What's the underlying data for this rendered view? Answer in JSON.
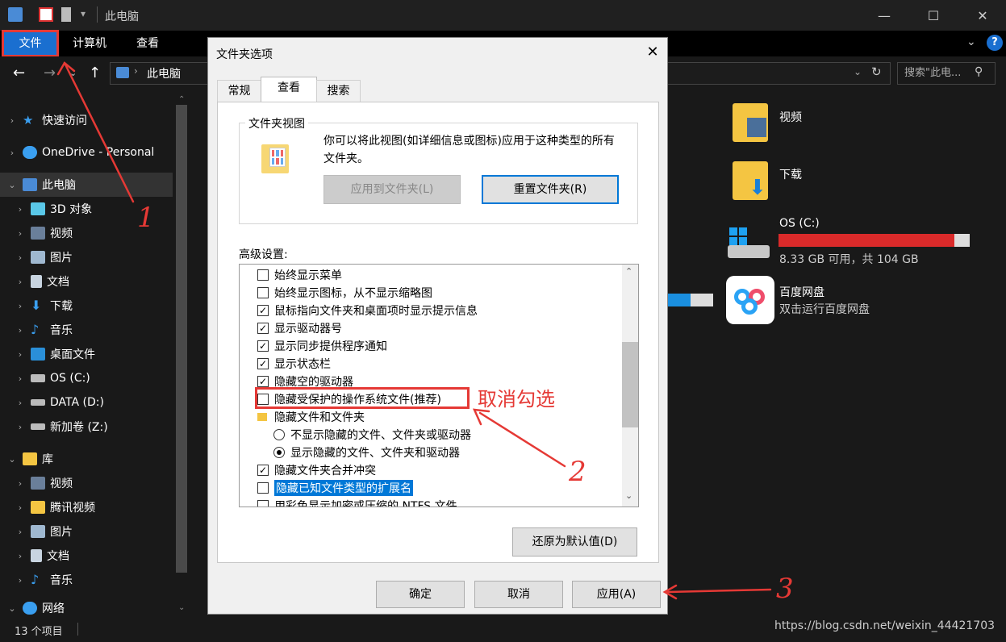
{
  "explorer": {
    "window_title": "此电脑",
    "ribbon_tabs": [
      "文件",
      "计算机",
      "查看"
    ],
    "address_path": "此电脑",
    "search_placeholder": "搜索\"此电...",
    "sidebar": [
      {
        "label": "快速访问",
        "icon": "star-icon"
      },
      {
        "label": "OneDrive - Personal",
        "icon": "cloud-icon"
      },
      {
        "label": "此电脑",
        "icon": "computer-icon"
      },
      {
        "label": "3D 对象",
        "icon": "cube-icon"
      },
      {
        "label": "视频",
        "icon": "video-icon"
      },
      {
        "label": "图片",
        "icon": "picture-icon"
      },
      {
        "label": "文档",
        "icon": "document-icon"
      },
      {
        "label": "下载",
        "icon": "download-icon"
      },
      {
        "label": "音乐",
        "icon": "music-icon"
      },
      {
        "label": "桌面文件",
        "icon": "desktop-icon"
      },
      {
        "label": "OS (C:)",
        "icon": "drive-icon"
      },
      {
        "label": "DATA (D:)",
        "icon": "drive-icon"
      },
      {
        "label": "新加卷 (Z:)",
        "icon": "drive-icon"
      },
      {
        "label": "库",
        "icon": "library-icon"
      },
      {
        "label": "视频",
        "icon": "video-icon"
      },
      {
        "label": "腾讯视频",
        "icon": "folder-icon"
      },
      {
        "label": "图片",
        "icon": "picture-icon"
      },
      {
        "label": "文档",
        "icon": "document-icon"
      },
      {
        "label": "音乐",
        "icon": "music-icon"
      },
      {
        "label": "网络",
        "icon": "network-icon"
      }
    ],
    "right_pane": {
      "videos": "视频",
      "downloads": "下载",
      "drive_c_name": "OS (C:)",
      "drive_c_free": "8.33 GB 可用，共 104 GB",
      "drive_c_used_fraction": 0.92,
      "baidu_name": "百度网盘",
      "baidu_desc": "双击运行百度网盘"
    },
    "status_count": "13 个项目",
    "watermark": "https://blog.csdn.net/weixin_44421703"
  },
  "dialog": {
    "title": "文件夹选项",
    "tabs": [
      "常规",
      "查看",
      "搜索"
    ],
    "folder_views_legend": "文件夹视图",
    "folder_views_desc": "你可以将此视图(如详细信息或图标)应用于这种类型的所有文件夹。",
    "btn_apply_to_folders": "应用到文件夹(L)",
    "btn_reset_folders": "重置文件夹(R)",
    "advanced_label": "高级设置:",
    "advanced_items": [
      {
        "label": "始终显示菜单",
        "type": "checkbox",
        "checked": false
      },
      {
        "label": "始终显示图标，从不显示缩略图",
        "type": "checkbox",
        "checked": false
      },
      {
        "label": "鼠标指向文件夹和桌面项时显示提示信息",
        "type": "checkbox",
        "checked": true
      },
      {
        "label": "显示驱动器号",
        "type": "checkbox",
        "checked": true
      },
      {
        "label": "显示同步提供程序通知",
        "type": "checkbox",
        "checked": true
      },
      {
        "label": "显示状态栏",
        "type": "checkbox",
        "checked": true
      },
      {
        "label": "隐藏空的驱动器",
        "type": "checkbox",
        "checked": true
      },
      {
        "label": "隐藏受保护的操作系统文件(推荐)",
        "type": "checkbox",
        "checked": false
      },
      {
        "label": "隐藏文件和文件夹",
        "type": "folder"
      },
      {
        "label": "不显示隐藏的文件、文件夹或驱动器",
        "type": "radio",
        "checked": false
      },
      {
        "label": "显示隐藏的文件、文件夹和驱动器",
        "type": "radio",
        "checked": true
      },
      {
        "label": "隐藏文件夹合并冲突",
        "type": "checkbox",
        "checked": true
      },
      {
        "label": "隐藏已知文件类型的扩展名",
        "type": "checkbox",
        "checked": false,
        "selected": true
      },
      {
        "label": "用彩色显示加密或压缩的 NTFS 文件",
        "type": "checkbox",
        "checked": false
      }
    ],
    "btn_restore_defaults": "还原为默认值(D)",
    "btn_ok": "确定",
    "btn_cancel": "取消",
    "btn_apply": "应用(A)"
  },
  "annotations": {
    "uncheck_note": "取消勾选",
    "step1": "1",
    "step2": "2",
    "step3": "3"
  },
  "colors": {
    "accent": "#0078d7",
    "annotation": "#e53935",
    "drive_bar": "#da2a2a"
  }
}
